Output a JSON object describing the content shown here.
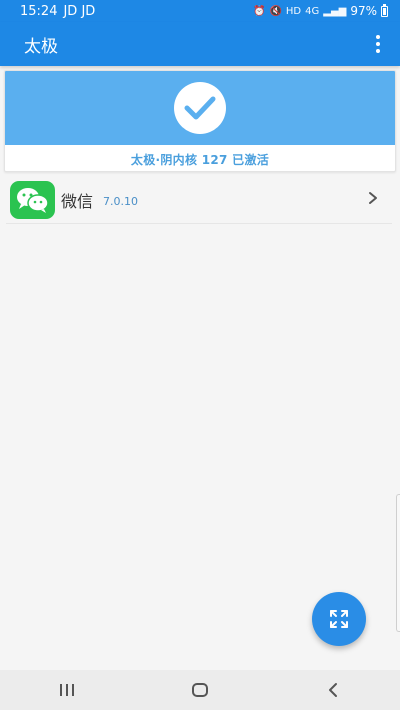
{
  "status_bar": {
    "time": "15:24",
    "carrier": "JD JD",
    "network": "4G",
    "hd": "HD",
    "battery": "97%"
  },
  "app_bar": {
    "title": "太极"
  },
  "status_card": {
    "message": "太极·阴内核 127 已激活"
  },
  "app_list": [
    {
      "name": "微信",
      "version": "7.0.10"
    }
  ],
  "colors": {
    "primary": "#1e88e5",
    "card_header": "#5aafef",
    "wechat_green": "#2bc350",
    "fab": "#2a8de6"
  },
  "icons": {
    "check": "check-circle-icon",
    "fab": "expand-icon",
    "overflow": "more-vert-icon"
  }
}
